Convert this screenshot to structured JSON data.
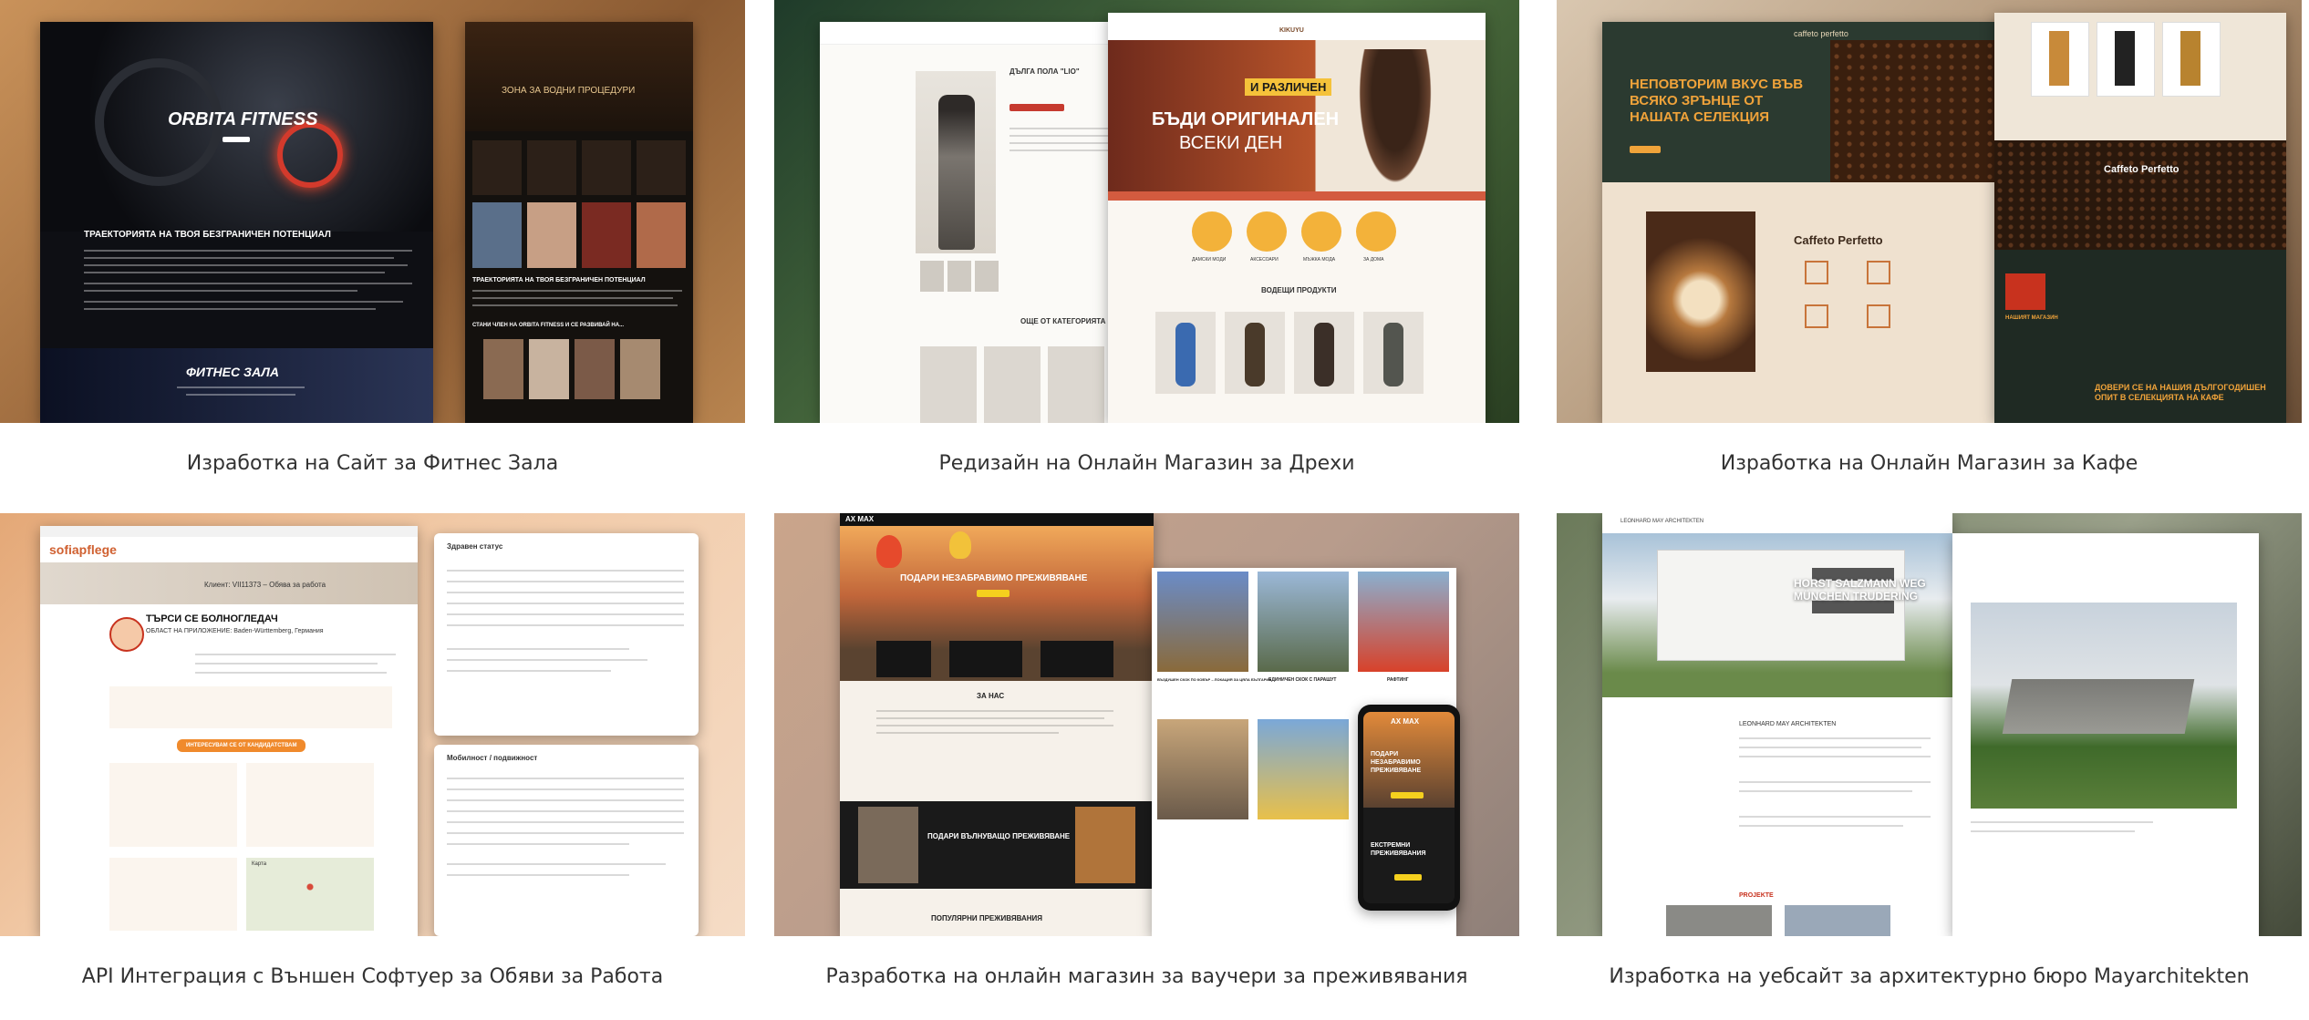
{
  "portfolio": {
    "items": [
      {
        "caption": "Изработка на Сайт за Фитнес Зала",
        "hero": "ORBITA FITNESS",
        "heading": "ТРАЕКТОРИЯТА НА ТВОЯ БЕЗГРАНИЧЕН ПОТЕНЦИАЛ",
        "section": "ФИТНЕС ЗАЛА",
        "right_title": "ЗОНА ЗА ВОДНИ ПРОЦЕДУРИ",
        "right_heading": "ТРАЕКТОРИЯТА НА ТВОЯ БЕЗГРАНИЧЕН ПОТЕНЦИАЛ",
        "member_text": "СТАНИ ЧЛЕН НА ORBITA FITNESS И СЕ РАЗВИВАЙ НА..."
      },
      {
        "caption": "Редизайн на Онлайн Магазин за Дрехи",
        "logo": "KIKUYU",
        "product_title": "ДЪЛГА ПОЛА \"LIO\"",
        "banner_line1": "БЪДИ ОРИГИНАЛЕН",
        "banner_line2": "ВСЕКИ ДЕН",
        "banner_tag": "И РАЗЛИЧЕН",
        "section": "ВОДЕЩИ ПРОДУКТИ",
        "more": "ОЩЕ ОТ КАТЕГОРИЯТА",
        "cats": [
          "ДАМСКИ МОДИ",
          "АКСЕСОАРИ",
          "МЪЖКА МОДА",
          "ЗА ДОМА"
        ]
      },
      {
        "caption": "Изработка на Онлайн Магазин за Кафе",
        "logo": "caffeto perfetto",
        "hero": "НЕПОВТОРИМ ВКУС ВЪВ ВСЯКО ЗРЪНЦЕ ОТ НАШАТА СЕЛЕКЦИЯ",
        "section": "Caffeto Perfetto",
        "right_title": "Caffeto Perfetto",
        "right_footer": "ДОВЕРИ СЕ НА НАШИЯ ДЪЛГОГОДИШЕН ОПИТ В СЕЛЕКЦИЯТА НА КАФЕ",
        "shop": "НАШИЯТ МАГАЗИН"
      },
      {
        "caption": "API Интеграция с Външен Софтуер за Обяви за Работа",
        "logo": "sofiapflege",
        "job_id": "Клиент: VII11373 – Обява за работа",
        "title": "ТЪРСИ СЕ БОЛНОГЛЕДАЧ",
        "subtitle": "ОБЛАСТ НА ПРИЛОЖЕНИЕ: Baden-Württemberg, Германия",
        "cta": "ИНТЕРЕСУВАМ СЕ ОТ КАНДИДАТСТВАМ",
        "panel1": "Здравен статус",
        "panel2": "Мобилност / подвижност",
        "map_label": "Карта"
      },
      {
        "caption": "Разработка на онлайн магазин за ваучери за преживявания",
        "logo": "AX MAX",
        "hero": "ПОДАРИ НЕЗАБРАВИМО ПРЕЖИВЯВАНЕ",
        "section": "ЗА НАС",
        "promo": "ПОДАРИ ВЪЛНУВАЩО ПРЕЖИВЯВАНЕ",
        "popular": "ПОПУЛЯРНИ ПРЕЖИВЯВАНИЯ",
        "phone_text": "ПОДАРИ НЕЗАБРАВИМО ПРЕЖИВЯВАНЕ",
        "phone_bottom": "ЕКСТРЕМНИ ПРЕЖИВЯВАНИЯ",
        "products": [
          "ВЪЗДУШЕН СКОК ПО КОВЪР – ЛОКАЦИЯ ЗА ЦЯЛА БЪЛГАРИЯ",
          "ЕДИНИЧЕН СКОК С ПАРАШУТ",
          "РАФТИНГ"
        ]
      },
      {
        "caption": "Изработка на уебсайт за архитектурно бюро Mayarchitekten",
        "logo": "LEONHARD MAY ARCHITEKTEN",
        "hero": "HORST SALZMANN WEG MÜNCHEN TRUDERING",
        "section": "LEONHARD MAY ARCHITEKTEN",
        "projects": "PROJEKTE"
      }
    ]
  }
}
